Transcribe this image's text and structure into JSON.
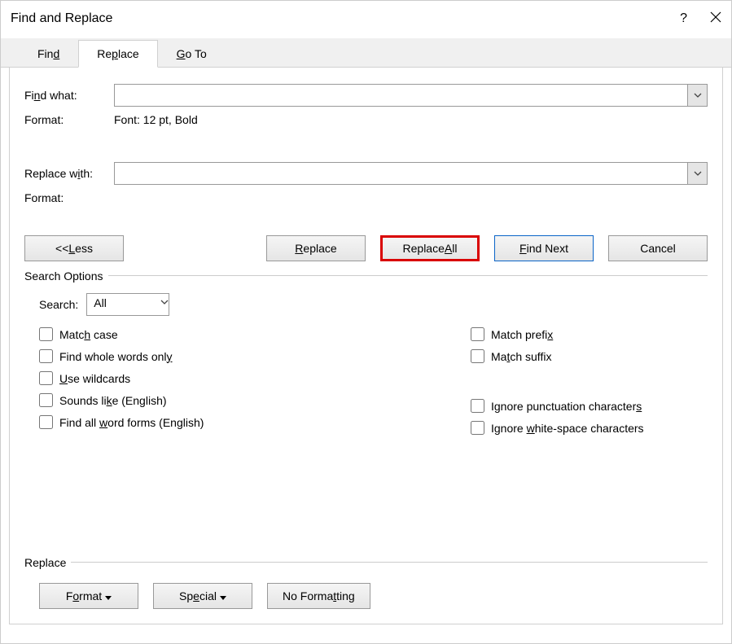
{
  "title": "Find and Replace",
  "tabs": {
    "find": "Find",
    "replace": "Replace",
    "goto": "Go To"
  },
  "labels": {
    "find_what": "Find what:",
    "format": "Format:",
    "replace_with": "Replace with:",
    "format2": "Format:",
    "search_options": "Search Options",
    "search": "Search:",
    "replace_section": "Replace"
  },
  "find_format_value": "Font: 12 pt, Bold",
  "replace_format_value": "",
  "find_value": "",
  "replace_value": "",
  "search_scope": "All",
  "buttons": {
    "less": "<< Less",
    "replace": "Replace",
    "replace_all": "Replace All",
    "find_next": "Find Next",
    "cancel": "Cancel",
    "format": "Format",
    "special": "Special",
    "no_formatting": "No Formatting"
  },
  "options_left": {
    "match_case": "Match case",
    "whole_words": "Find whole words only",
    "wildcards": "Use wildcards",
    "sounds_like": "Sounds like (English)",
    "word_forms": "Find all word forms (English)"
  },
  "options_right": {
    "match_prefix": "Match prefix",
    "match_suffix": "Match suffix",
    "ignore_punct": "Ignore punctuation characters",
    "ignore_ws": "Ignore white-space characters"
  }
}
